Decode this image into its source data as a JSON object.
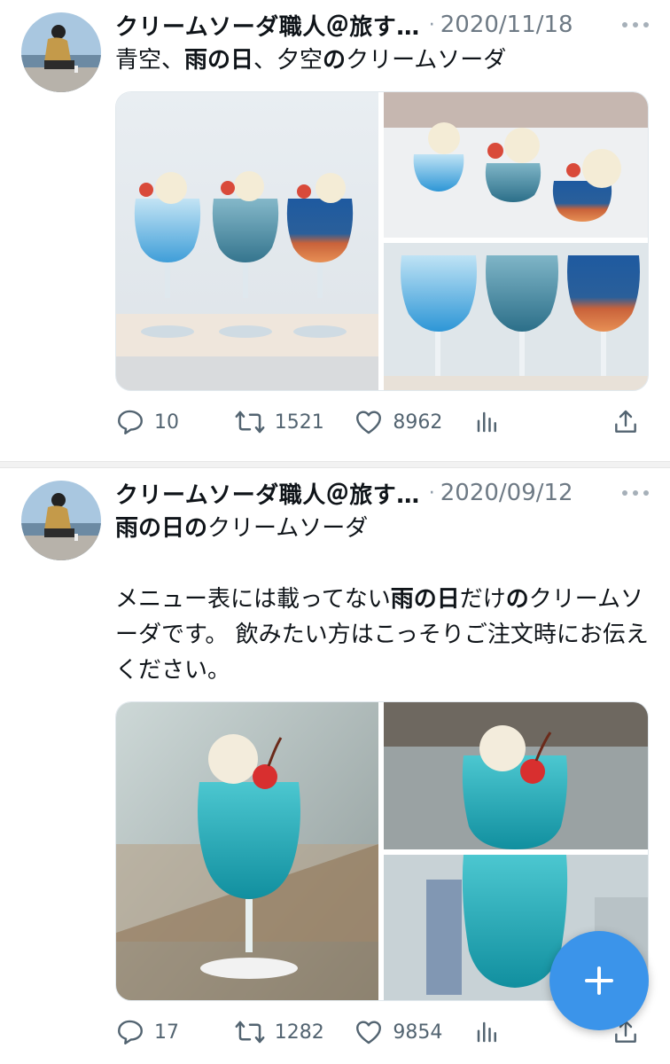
{
  "tweets": [
    {
      "author": "クリームソーダ職人＠旅す…",
      "separator": "·",
      "date": "2020/11/18",
      "text_segments": [
        {
          "text": "青空、",
          "bold": false
        },
        {
          "text": "雨の日",
          "bold": true
        },
        {
          "text": "、夕空",
          "bold": false
        },
        {
          "text": "の",
          "bold": true
        },
        {
          "text": "クリームソーダ",
          "bold": false
        }
      ],
      "stats": {
        "replies": "10",
        "retweets": "1521",
        "likes": "8962"
      }
    },
    {
      "author": "クリームソーダ職人＠旅す…",
      "separator": "·",
      "date": "2020/09/12",
      "line1": [
        {
          "text": "雨の日の",
          "bold": true
        },
        {
          "text": "クリームソーダ",
          "bold": false
        }
      ],
      "para2": [
        {
          "text": "メニュー表には載ってない",
          "bold": false
        },
        {
          "text": "雨の日",
          "bold": true
        },
        {
          "text": "だけ",
          "bold": false
        },
        {
          "text": "の",
          "bold": true
        },
        {
          "text": "クリームソーダです。 飲みたい方はこっそりご注文時にお伝えください。",
          "bold": false
        }
      ],
      "stats": {
        "replies": "17",
        "retweets": "1282",
        "likes": "9854"
      }
    }
  ],
  "icons": {
    "reply": "speech-bubble-icon",
    "retweet": "retweet-arrows-icon",
    "like": "heart-icon",
    "views": "bar-chart-icon",
    "share": "share-upload-icon",
    "more": "more-dots-icon",
    "compose": "plus-icon"
  },
  "colors": {
    "accent": "#3b94ea",
    "text": "#0f1419",
    "muted": "#536471"
  }
}
